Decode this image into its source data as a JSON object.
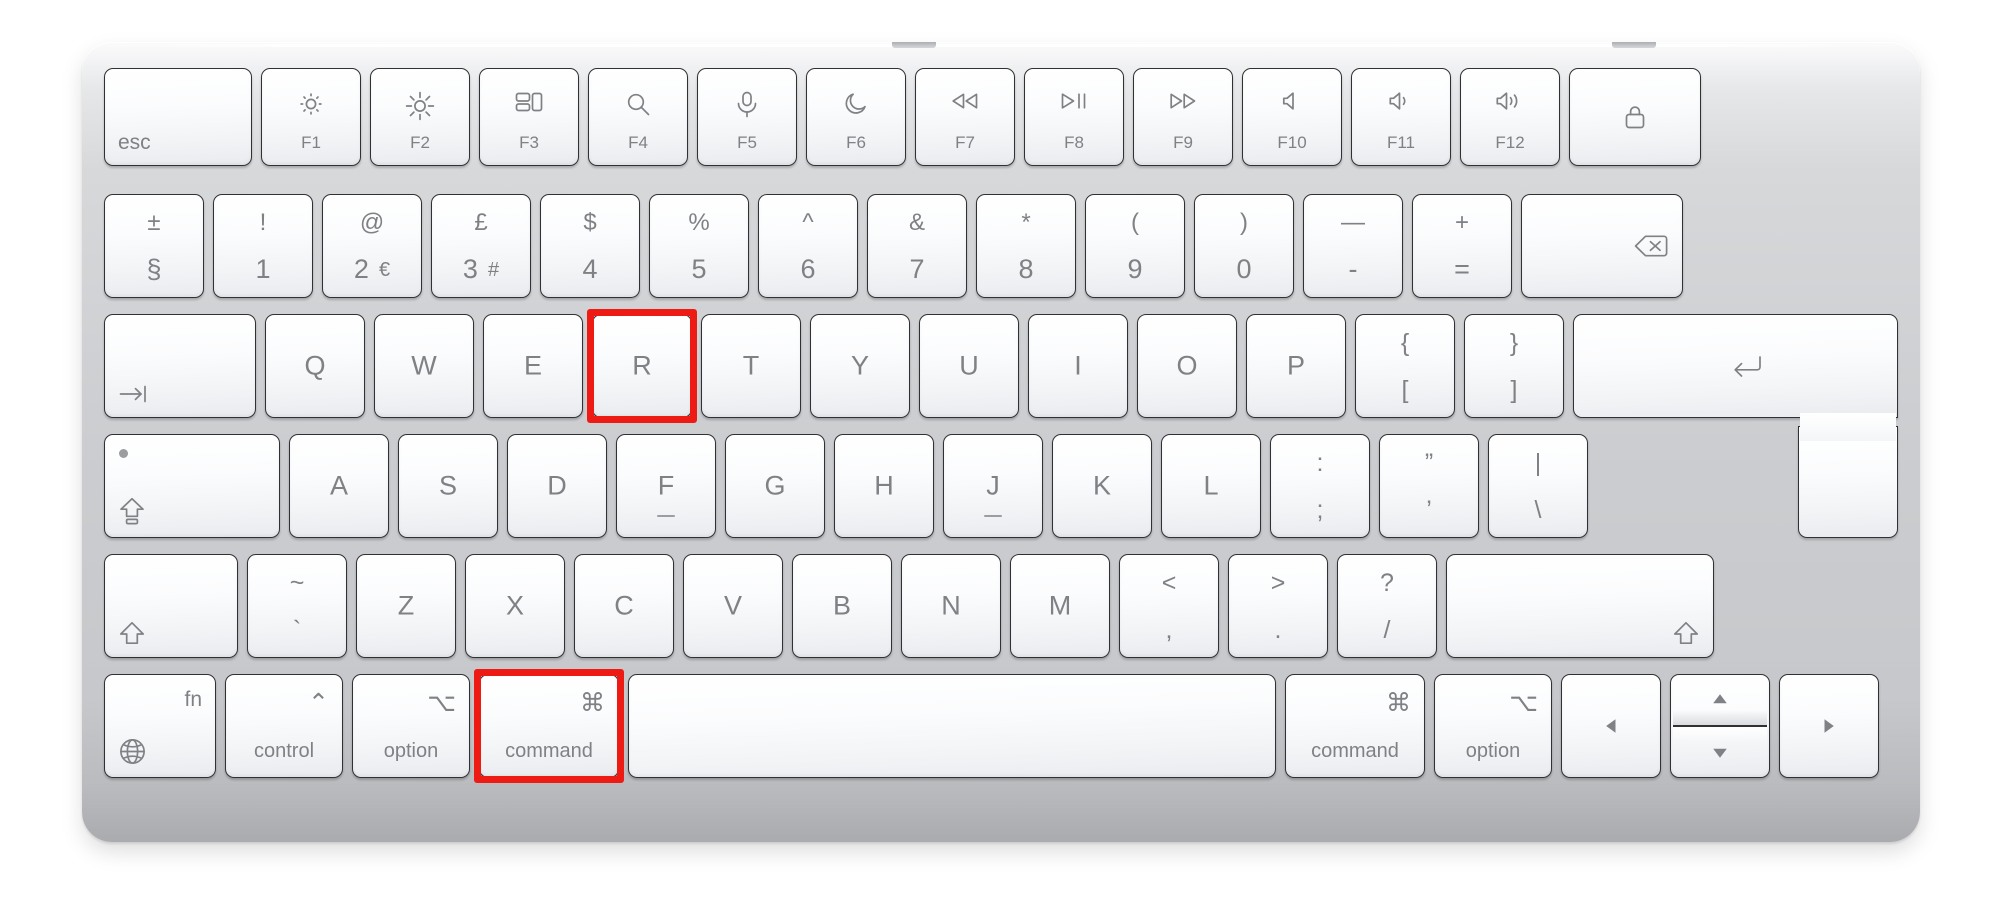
{
  "device": {
    "name": "Apple Magic Keyboard with Touch ID",
    "layout": "UK / ISO",
    "chassis_color": "#cbcdd0",
    "key_color": "#f5f6f8",
    "legend_color": "#7f8185",
    "highlight_color": "#ee1b15"
  },
  "highlighted_keys": [
    "R",
    "command"
  ],
  "shortcut": "command + R",
  "rows": {
    "function_row": [
      {
        "id": "esc",
        "label": "esc",
        "icon": null,
        "icon_name": null
      },
      {
        "id": "f1",
        "label": "F1",
        "icon": "brightness-down",
        "icon_name": "brightness-down-icon"
      },
      {
        "id": "f2",
        "label": "F2",
        "icon": "brightness-up",
        "icon_name": "brightness-up-icon"
      },
      {
        "id": "f3",
        "label": "F3",
        "icon": "mission-control",
        "icon_name": "mission-control-icon"
      },
      {
        "id": "f4",
        "label": "F4",
        "icon": "spotlight",
        "icon_name": "search-icon"
      },
      {
        "id": "f5",
        "label": "F5",
        "icon": "dictation",
        "icon_name": "microphone-icon"
      },
      {
        "id": "f6",
        "label": "F6",
        "icon": "do-not-disturb",
        "icon_name": "moon-icon"
      },
      {
        "id": "f7",
        "label": "F7",
        "icon": "rewind",
        "icon_name": "rewind-icon"
      },
      {
        "id": "f8",
        "label": "F8",
        "icon": "play-pause",
        "icon_name": "play-pause-icon"
      },
      {
        "id": "f9",
        "label": "F9",
        "icon": "fast-forward",
        "icon_name": "fast-forward-icon"
      },
      {
        "id": "f10",
        "label": "F10",
        "icon": "mute",
        "icon_name": "volume-mute-icon"
      },
      {
        "id": "f11",
        "label": "F11",
        "icon": "volume-down",
        "icon_name": "volume-down-icon"
      },
      {
        "id": "f12",
        "label": "F12",
        "icon": "volume-up",
        "icon_name": "volume-up-icon"
      },
      {
        "id": "touchid",
        "label": "",
        "icon": "lock",
        "icon_name": "lock-icon"
      }
    ],
    "number_row": [
      {
        "id": "section",
        "top": "±",
        "bottom": "§",
        "alt": null
      },
      {
        "id": "1",
        "top": "!",
        "bottom": "1",
        "alt": null
      },
      {
        "id": "2",
        "top": "@",
        "bottom": "2",
        "alt": "€"
      },
      {
        "id": "3",
        "top": "£",
        "bottom": "3",
        "alt": "#"
      },
      {
        "id": "4",
        "top": "$",
        "bottom": "4",
        "alt": null
      },
      {
        "id": "5",
        "top": "%",
        "bottom": "5",
        "alt": null
      },
      {
        "id": "6",
        "top": "^",
        "bottom": "6",
        "alt": null
      },
      {
        "id": "7",
        "top": "&",
        "bottom": "7",
        "alt": null
      },
      {
        "id": "8",
        "top": "*",
        "bottom": "8",
        "alt": null
      },
      {
        "id": "9",
        "top": "(",
        "bottom": "9",
        "alt": null
      },
      {
        "id": "0",
        "top": ")",
        "bottom": "0",
        "alt": null
      },
      {
        "id": "minus",
        "top": "—",
        "bottom": "-",
        "alt": null
      },
      {
        "id": "equal",
        "top": "+",
        "bottom": "=",
        "alt": null
      },
      {
        "id": "delete",
        "top": null,
        "bottom": null,
        "alt": null,
        "icon_name": "delete-backspace-icon"
      }
    ],
    "qwerty_row": [
      {
        "id": "tab",
        "label": "",
        "icon_name": "tab-icon"
      },
      {
        "id": "Q",
        "label": "Q"
      },
      {
        "id": "W",
        "label": "W"
      },
      {
        "id": "E",
        "label": "E"
      },
      {
        "id": "R",
        "label": "R",
        "highlighted": true
      },
      {
        "id": "T",
        "label": "T"
      },
      {
        "id": "Y",
        "label": "Y"
      },
      {
        "id": "U",
        "label": "U"
      },
      {
        "id": "I",
        "label": "I"
      },
      {
        "id": "O",
        "label": "O"
      },
      {
        "id": "P",
        "label": "P"
      },
      {
        "id": "bracketleft",
        "top": "{",
        "bottom": "["
      },
      {
        "id": "bracketright",
        "top": "}",
        "bottom": "]"
      },
      {
        "id": "return",
        "label": "",
        "icon_name": "return-icon"
      }
    ],
    "home_row": [
      {
        "id": "capslock",
        "label": "",
        "icon_name": "caps-lock-icon"
      },
      {
        "id": "A",
        "label": "A"
      },
      {
        "id": "S",
        "label": "S"
      },
      {
        "id": "D",
        "label": "D"
      },
      {
        "id": "F",
        "label": "F",
        "homing_bar": true
      },
      {
        "id": "G",
        "label": "G"
      },
      {
        "id": "H",
        "label": "H"
      },
      {
        "id": "J",
        "label": "J",
        "homing_bar": true
      },
      {
        "id": "K",
        "label": "K"
      },
      {
        "id": "L",
        "label": "L"
      },
      {
        "id": "semicolon",
        "top": ":",
        "bottom": ";"
      },
      {
        "id": "quote",
        "top": "”",
        "bottom": "’"
      },
      {
        "id": "backslash",
        "top": "|",
        "bottom": "\\"
      }
    ],
    "zxcv_row": [
      {
        "id": "shift-left",
        "label": "",
        "icon_name": "shift-icon"
      },
      {
        "id": "grave",
        "top": "~",
        "bottom": "`"
      },
      {
        "id": "Z",
        "label": "Z"
      },
      {
        "id": "X",
        "label": "X"
      },
      {
        "id": "C",
        "label": "C"
      },
      {
        "id": "V",
        "label": "V"
      },
      {
        "id": "B",
        "label": "B"
      },
      {
        "id": "N",
        "label": "N"
      },
      {
        "id": "M",
        "label": "M"
      },
      {
        "id": "comma",
        "top": "<",
        "bottom": ","
      },
      {
        "id": "period",
        "top": ">",
        "bottom": "."
      },
      {
        "id": "slash",
        "top": "?",
        "bottom": "/"
      },
      {
        "id": "shift-right",
        "label": "",
        "icon_name": "shift-icon"
      }
    ],
    "bottom_row": [
      {
        "id": "fn",
        "label": "fn",
        "icon_name": "globe-icon"
      },
      {
        "id": "control",
        "label": "control",
        "symbol": "⌃",
        "icon_name": "control-symbol-icon"
      },
      {
        "id": "option-left",
        "label": "option",
        "symbol": "⌥",
        "icon_name": "option-symbol-icon"
      },
      {
        "id": "command-left",
        "label": "command",
        "symbol": "⌘",
        "icon_name": "command-symbol-icon",
        "highlighted": true
      },
      {
        "id": "space",
        "label": "",
        "symbol": null
      },
      {
        "id": "command-right",
        "label": "command",
        "symbol": "⌘",
        "icon_name": "command-symbol-icon"
      },
      {
        "id": "option-right",
        "label": "option",
        "symbol": "⌥",
        "icon_name": "option-symbol-icon"
      },
      {
        "id": "arrow-left",
        "label": "",
        "icon_name": "arrow-left-icon"
      },
      {
        "id": "arrow-updown",
        "label": "",
        "icon_name": "arrow-up-down-icon"
      },
      {
        "id": "arrow-right",
        "label": "",
        "icon_name": "arrow-right-icon"
      }
    ]
  }
}
